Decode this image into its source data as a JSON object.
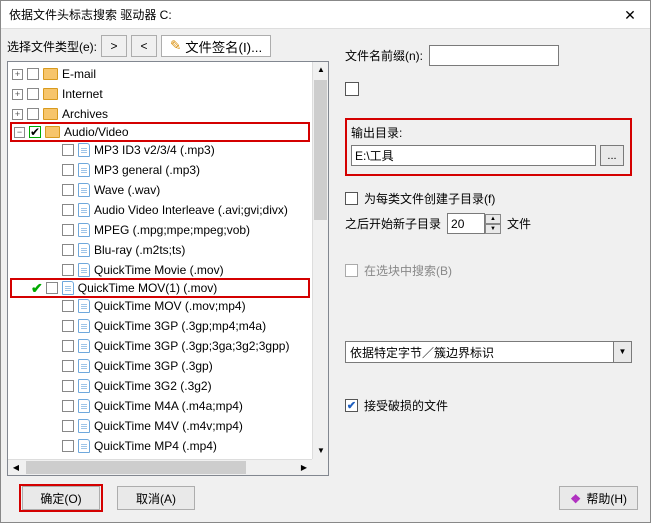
{
  "title": "依据文件头标志搜索 驱动器 C:",
  "left": {
    "select_label": "选择文件类型(e):",
    "btn_next": ">",
    "btn_prev": "<",
    "sig_label": "文件签名(I)...",
    "tree": {
      "email": "E-mail",
      "internet": "Internet",
      "archives": "Archives",
      "av": "Audio/Video",
      "items": [
        "MP3 ID3 v2/3/4 (.mp3)",
        "MP3 general (.mp3)",
        "Wave (.wav)",
        "Audio Video Interleave (.avi;gvi;divx)",
        "MPEG (.mpg;mpe;mpeg;vob)",
        "Blu-ray (.m2ts;ts)",
        "QuickTime Movie (.mov)",
        "QuickTime MOV(1) (.mov)",
        "QuickTime MOV (.mov;mp4)",
        "QuickTime 3GP (.3gp;mp4;m4a)",
        "QuickTime 3GP (.3gp;3ga;3g2;3gpp)",
        "QuickTime 3GP (.3gp)",
        "QuickTime 3G2 (.3g2)",
        "QuickTime M4A (.m4a;mp4)",
        "QuickTime M4V (.m4v;mp4)",
        "QuickTime MP4 (.mp4)"
      ]
    }
  },
  "right": {
    "prefix_label": "文件名前缀(n):",
    "prefix_value": "",
    "out_label": "输出目录:",
    "out_value": "E:\\工具",
    "browse": "...",
    "subdir_label": "为每类文件创建子目录(f)",
    "subdir_next": "之后开始新子目录",
    "files_suffix": "文件",
    "spin_value": "20",
    "search_sel": "在选块中搜索(B)",
    "dropdown": "依据特定字节／簇边界标识",
    "accept_broken": "接受破损的文件"
  },
  "footer": {
    "ok": "确定(O)",
    "cancel": "取消(A)",
    "help": "帮助(H)"
  }
}
